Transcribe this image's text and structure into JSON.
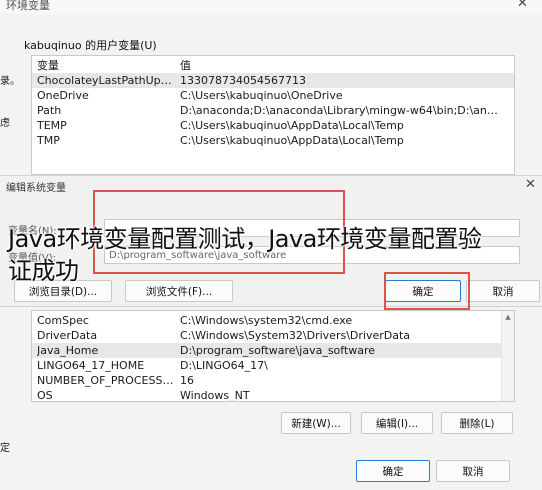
{
  "back_window": {
    "title": "环境变量",
    "left_edge": [
      "录。",
      "虑"
    ],
    "user_vars_label": "kabuqinuo 的用户变量(U)",
    "columns": {
      "name": "变量",
      "value": "值"
    },
    "user_vars": [
      {
        "name": "ChocolateyLastPathUpdate",
        "value": "133078734054567713",
        "selected": true
      },
      {
        "name": "OneDrive",
        "value": "C:\\Users\\kabuqinuo\\OneDrive"
      },
      {
        "name": "Path",
        "value": "D:\\anaconda;D:\\anaconda\\Library\\mingw-w64\\bin;D:\\anaconda\\Li..."
      },
      {
        "name": "TEMP",
        "value": "C:\\Users\\kabuqinuo\\AppData\\Local\\Temp"
      },
      {
        "name": "TMP",
        "value": "C:\\Users\\kabuqinuo\\AppData\\Local\\Temp"
      }
    ],
    "system_vars": [
      {
        "name": "ComSpec",
        "value": "C:\\Windows\\system32\\cmd.exe"
      },
      {
        "name": "DriverData",
        "value": "C:\\Windows\\System32\\Drivers\\DriverData"
      },
      {
        "name": "Java_Home",
        "value": "D:\\program_software\\java_software",
        "selected": true
      },
      {
        "name": "LINGO64_17_HOME",
        "value": "D:\\LINGO64_17\\"
      },
      {
        "name": "NUMBER_OF_PROCESSORS",
        "value": "16"
      },
      {
        "name": "OS",
        "value": "Windows_NT"
      }
    ],
    "buttons": {
      "new": "新建(W)...",
      "edit": "编辑(I)...",
      "delete": "删除(L)",
      "ok": "确定",
      "cancel": "取消"
    },
    "bottom_left": "定"
  },
  "edit_dialog": {
    "title": "编辑系统变量",
    "name_label": "变量名(N):",
    "value_label": "变量值(V):",
    "value_text": "D:\\program_software\\java_software",
    "browse_dir": "浏览目录(D)...",
    "browse_file": "浏览文件(F)...",
    "ok": "确定",
    "cancel": "取消"
  },
  "overlay": {
    "line1": "Java环境变量配置测试，Java环境变量配置验",
    "line2": "证成功"
  },
  "colors": {
    "highlight": "#d9534f",
    "accent": "#2b7bd4"
  },
  "icons": [
    "close-icon",
    "scroll-up-icon",
    "scroll-down-icon"
  ]
}
